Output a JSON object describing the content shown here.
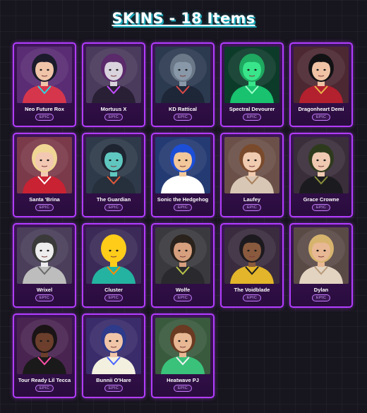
{
  "header": {
    "title": "SKINS - 18 Items"
  },
  "theme": {
    "accent": "#b23cff",
    "card_bg": "#2f0f45",
    "title_shadow": "#1aa7b8",
    "background": "#17151d"
  },
  "skins": [
    {
      "name": "Neo Future Rox",
      "rarity": "EPIC",
      "bg": "#5a2c74",
      "skin": "#f0c4a8",
      "hair": "#1b1b2b",
      "outfit": "#d6364c",
      "accent": "#2fd5e0"
    },
    {
      "name": "Mortuus X",
      "rarity": "EPIC",
      "bg": "#4a3a5c",
      "skin": "#d9d3dd",
      "hair": "#5a2a6a",
      "outfit": "#2a2036",
      "accent": "#c44cff"
    },
    {
      "name": "KD Rattical",
      "rarity": "EPIC",
      "bg": "#2c3a50",
      "skin": "#8898a8",
      "hair": "#6a7888",
      "outfit": "#1d2738",
      "accent": "#d84848"
    },
    {
      "name": "Spectral Devourer",
      "rarity": "EPIC",
      "bg": "#0d3b2a",
      "skin": "#39e58a",
      "hair": "#1ea860",
      "outfit": "#18c26e",
      "accent": "#9dffc8"
    },
    {
      "name": "Dragonheart Demi",
      "rarity": "EPIC",
      "bg": "#4c2832",
      "skin": "#efc3a4",
      "hair": "#121214",
      "outfit": "#b3202e",
      "accent": "#e8b34a"
    },
    {
      "name": "Santa 'Brina",
      "rarity": "EPIC",
      "bg": "#7a3a4a",
      "skin": "#f3c8b2",
      "hair": "#f0d694",
      "outfit": "#c92233",
      "accent": "#ffffff"
    },
    {
      "name": "The Guardian",
      "rarity": "EPIC",
      "bg": "#2e3a4a",
      "skin": "#5fc7c0",
      "hair": "#1e2430",
      "outfit": "#25303c",
      "accent": "#e25a3a"
    },
    {
      "name": "Sonic the Hedgehog",
      "rarity": "EPIC",
      "bg": "#243a72",
      "skin": "#f2c79a",
      "hair": "#1c4fd6",
      "outfit": "#ffffff",
      "accent": "#ffffff"
    },
    {
      "name": "Laufey",
      "rarity": "EPIC",
      "bg": "#6a5048",
      "skin": "#f1cbb0",
      "hair": "#7a4a2c",
      "outfit": "#d8c7b4",
      "accent": "#a97f5a"
    },
    {
      "name": "Grace Crowne",
      "rarity": "EPIC",
      "bg": "#3a2e3a",
      "skin": "#efc9b0",
      "hair": "#2e3a1c",
      "outfit": "#1b1b1f",
      "accent": "#8a8f3a"
    },
    {
      "name": "Wrixel",
      "rarity": "EPIC",
      "bg": "#4a3e5a",
      "skin": "#ededed",
      "hair": "#3a3a3a",
      "outfit": "#bdbdbd",
      "accent": "#6a6a6a"
    },
    {
      "name": "Cluster",
      "rarity": "EPIC",
      "bg": "#3b2a58",
      "skin": "#ffcc1a",
      "hair": "#ffcc1a",
      "outfit": "#24b3a0",
      "accent": "#ff8a00"
    },
    {
      "name": "Wolfe",
      "rarity": "EPIC",
      "bg": "#3a3a3e",
      "skin": "#d6a07e",
      "hair": "#2a221c",
      "outfit": "#2a2a2e",
      "accent": "#b9c24a"
    },
    {
      "name": "The Voidblade",
      "rarity": "EPIC",
      "bg": "#3a2c3e",
      "skin": "#8a5a3e",
      "hair": "#1d1a1f",
      "outfit": "#e2b52a",
      "accent": "#1c1c1c"
    },
    {
      "name": "Dylan",
      "rarity": "EPIC",
      "bg": "#5a4a46",
      "skin": "#e8b894",
      "hair": "#d7b46e",
      "outfit": "#e3d4c2",
      "accent": "#b89a7a"
    },
    {
      "name": "Tour Ready Lil Tecca",
      "rarity": "EPIC",
      "bg": "#4a2450",
      "skin": "#6b3f2c",
      "hair": "#1a1416",
      "outfit": "#1a1a1a",
      "accent": "#ff4fa8"
    },
    {
      "name": "Bunnii O'Hare",
      "rarity": "EPIC",
      "bg": "#3a2c6a",
      "skin": "#f1c6a8",
      "hair": "#2e3a8a",
      "outfit": "#f3f0e0",
      "accent": "#4a64ff"
    },
    {
      "name": "Heatwave PJ",
      "rarity": "EPIC",
      "bg": "#3a5a3e",
      "skin": "#e8b894",
      "hair": "#6a3a22",
      "outfit": "#3ac27a",
      "accent": "#f2f2f2"
    }
  ]
}
